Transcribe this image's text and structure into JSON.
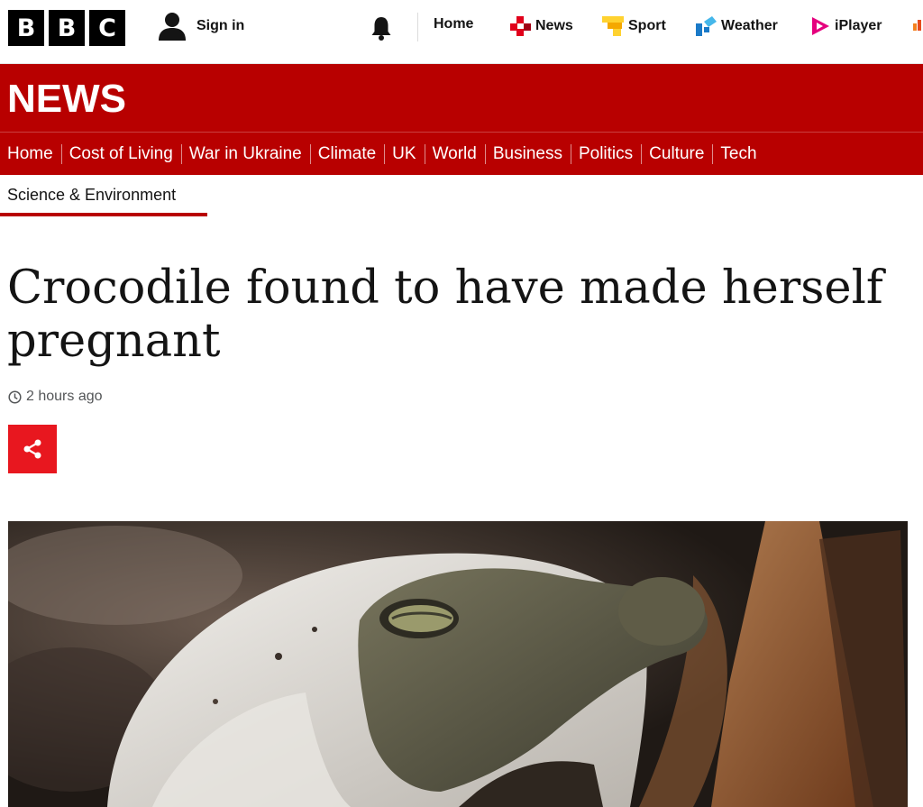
{
  "brand": {
    "letters": [
      "B",
      "B",
      "C"
    ]
  },
  "header": {
    "signin_label": "Sign in",
    "nav": [
      {
        "label": "Home",
        "icon": "none"
      },
      {
        "label": "News",
        "icon": "news-icon",
        "color": "#e1001b"
      },
      {
        "label": "Sport",
        "icon": "sport-icon",
        "color": "#ffd230"
      },
      {
        "label": "Weather",
        "icon": "weather-icon",
        "color": "#1a7ac8"
      },
      {
        "label": "iPlayer",
        "icon": "iplayer-icon",
        "color": "#e5007e"
      }
    ]
  },
  "news": {
    "title": "NEWS",
    "subnav": [
      "Home",
      "Cost of Living",
      "War in Ukraine",
      "Climate",
      "UK",
      "World",
      "Business",
      "Politics",
      "Culture",
      "Tech"
    ]
  },
  "section": {
    "label": "Science & Environment"
  },
  "article": {
    "headline": "Crocodile found to have made herself pregnant",
    "timestamp": "2 hours ago"
  },
  "colors": {
    "brand_red": "#b80000",
    "share_red": "#e8171f"
  }
}
